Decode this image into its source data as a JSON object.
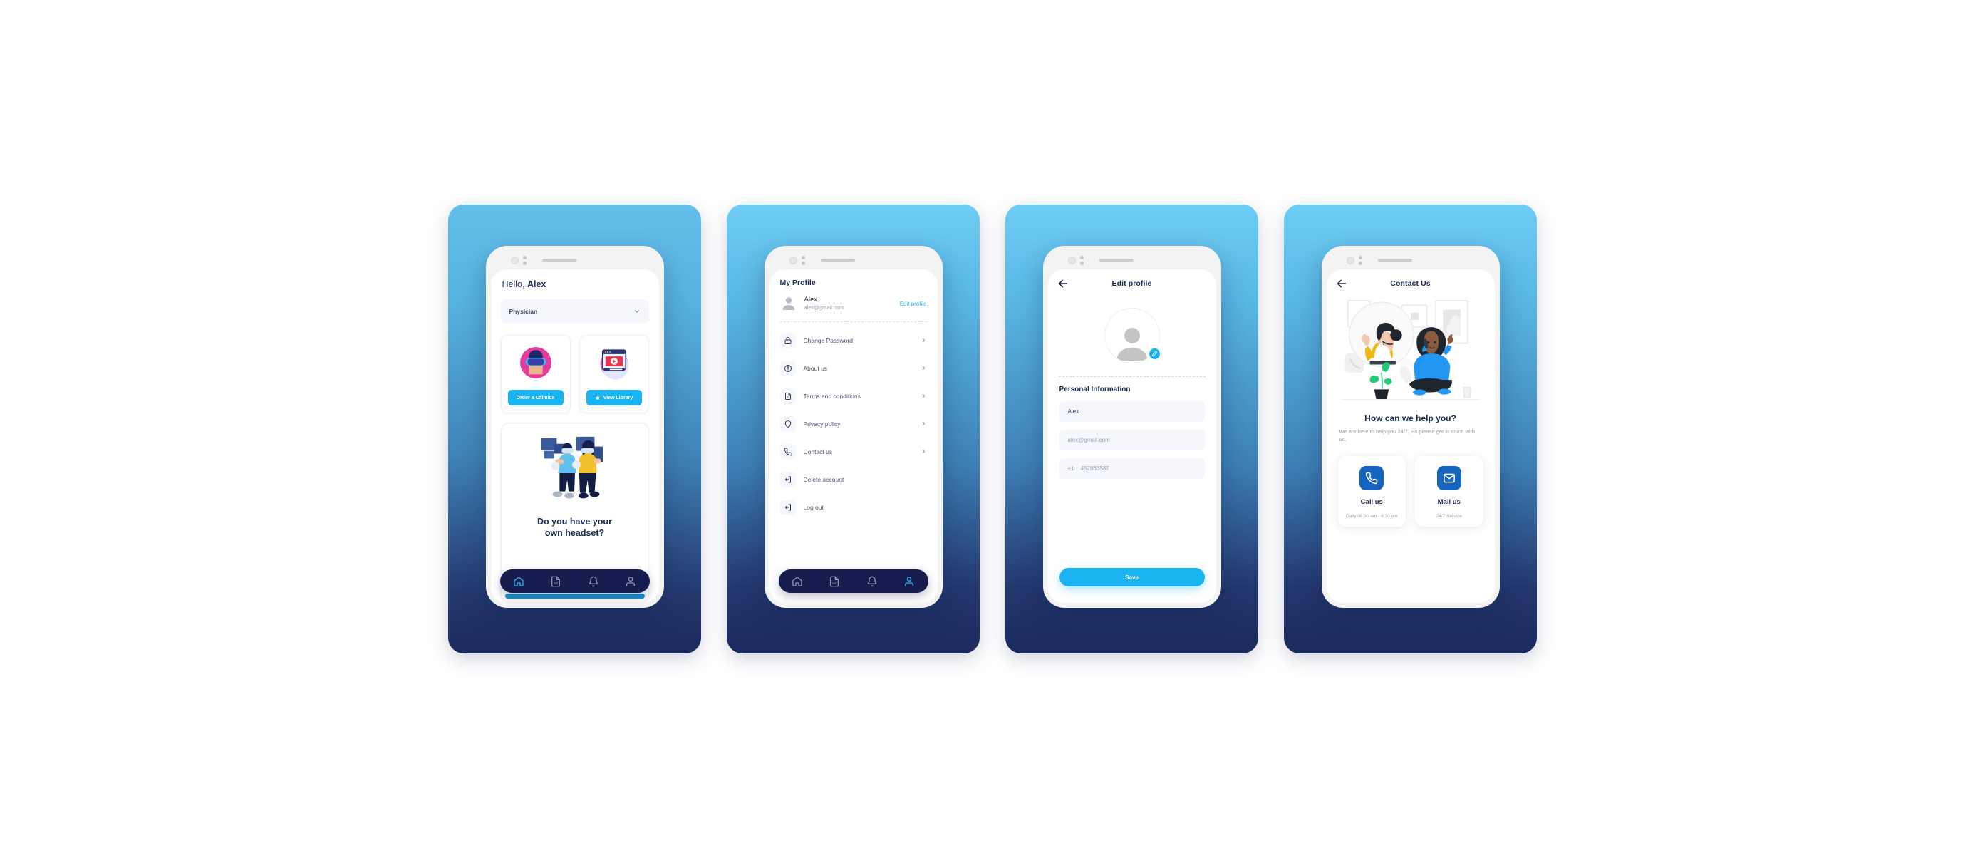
{
  "panels": [
    {
      "name": "home-screen"
    },
    {
      "name": "my-profile-screen"
    },
    {
      "name": "edit-profile-screen"
    },
    {
      "name": "contact-us-screen"
    }
  ],
  "colors": {
    "accent_blue": "#18b3f0",
    "nav_navy": "#161d4e",
    "heading_navy": "#1d2a51",
    "card_blue": "#1565c0",
    "panel_top": "#6ecdf4",
    "panel_bottom": "#1b2a5e",
    "field_bg": "#f5f7fd",
    "muted_text": "#9aa0ae"
  },
  "home": {
    "greeting_prefix": "Hello, ",
    "greeting_name": "Alex",
    "role_select": {
      "value": "Physician",
      "chevron": "chevron-down-icon"
    },
    "tiles": [
      {
        "art": "vr-headset-user-icon",
        "button_label": "Order a Calmica",
        "button_icon": ""
      },
      {
        "art": "video-player-window-icon",
        "button_label": "View Library",
        "button_icon": "lock-icon"
      }
    ],
    "promo": {
      "art": "two-people-vr-icon",
      "title_line1": "Do you have your",
      "title_line2": "own headset?"
    },
    "tabs": [
      {
        "icon": "home-icon",
        "active": true
      },
      {
        "icon": "document-icon",
        "active": false
      },
      {
        "icon": "bell-icon",
        "active": false
      },
      {
        "icon": "person-icon",
        "active": false
      }
    ]
  },
  "profile": {
    "title": "My Profile",
    "user": {
      "name": "Alex",
      "email": "alex@gmail.com",
      "avatar": "person-avatar-icon"
    },
    "edit_link": "Edit profile",
    "menu": [
      {
        "label": "Change Password",
        "icon": "lock-icon",
        "chevron": true
      },
      {
        "label": "About us",
        "icon": "info-circle-icon",
        "chevron": true
      },
      {
        "label": "Terms and conditions",
        "icon": "document-icon",
        "chevron": true
      },
      {
        "label": "Privacy policy",
        "icon": "shield-icon",
        "chevron": true
      },
      {
        "label": "Contact us",
        "icon": "phone-icon",
        "chevron": true
      },
      {
        "label": "Delete account",
        "icon": "logout-icon",
        "chevron": false
      },
      {
        "label": "Log out",
        "icon": "logout-icon",
        "chevron": false
      }
    ],
    "tabs": [
      {
        "icon": "home-icon",
        "active": false
      },
      {
        "icon": "document-icon",
        "active": false
      },
      {
        "icon": "bell-icon",
        "active": false
      },
      {
        "icon": "person-icon",
        "active": true
      }
    ]
  },
  "edit_profile": {
    "title": "Edit profile",
    "back_icon": "back-arrow-icon",
    "avatar": "person-avatar-icon",
    "avatar_edit_icon": "pencil-icon",
    "section_title": "Personal Information",
    "fields": [
      {
        "name": "full-name",
        "value": "Alex",
        "state": "filled"
      },
      {
        "name": "email",
        "value": "alex@gmail.com",
        "state": "muted"
      },
      {
        "name": "phone",
        "country_code": "+1",
        "value": "452863587",
        "state": "muted"
      }
    ],
    "save_label": "Save"
  },
  "contact": {
    "title": "Contact Us",
    "back_icon": "back-arrow-icon",
    "illustration": "customer-support-call-illustration",
    "heading": "How can we help you?",
    "subtext": "We are here to help you 24/7, So please get in touch with us.",
    "cards": [
      {
        "icon": "phone-icon",
        "label": "Call us",
        "note": "Daily 09:30 am - 6:30 pm"
      },
      {
        "icon": "mail-icon",
        "label": "Mail us",
        "note": "24/7 Service"
      }
    ]
  }
}
